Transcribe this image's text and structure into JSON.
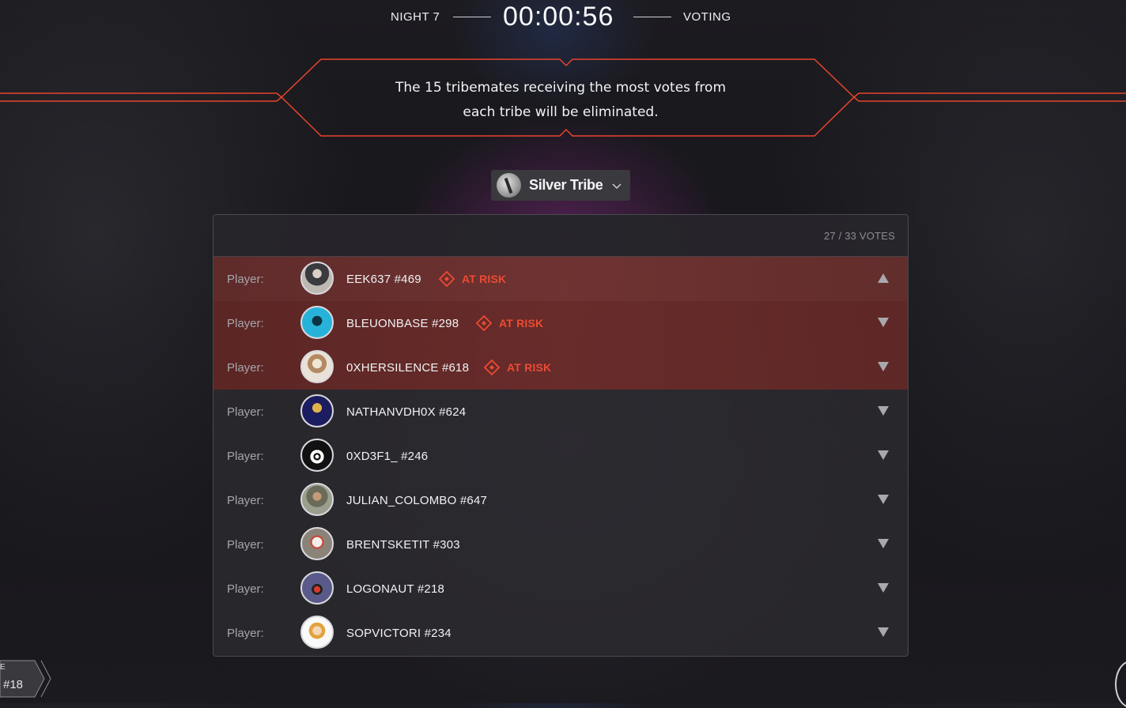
{
  "header": {
    "night": "NIGHT 7",
    "timer": "00:00:56",
    "phase": "VOTING"
  },
  "banner": {
    "message": "The 15 tribemates receiving the most votes from each tribe will be eliminated."
  },
  "tribe_selector": {
    "label": "Silver Tribe"
  },
  "panel": {
    "votes": "27 / 33 VOTES",
    "risk_label": "AT RISK",
    "rows": [
      {
        "label": "Player:",
        "name": "EEK637 #469",
        "at_risk": true,
        "arrow": "up"
      },
      {
        "label": "Player:",
        "name": "BLEUONBASE #298",
        "at_risk": true,
        "arrow": "down"
      },
      {
        "label": "Player:",
        "name": "0XHERSILENCE #618",
        "at_risk": true,
        "arrow": "down"
      },
      {
        "label": "Player:",
        "name": "NATHANVDH0X #624",
        "at_risk": false,
        "arrow": "down"
      },
      {
        "label": "Player:",
        "name": "0XD3F1_ #246",
        "at_risk": false,
        "arrow": "down"
      },
      {
        "label": "Player:",
        "name": "JULIAN_COLOMBO #647",
        "at_risk": false,
        "arrow": "down"
      },
      {
        "label": "Player:",
        "name": "BRENTSKETIT #303",
        "at_risk": false,
        "arrow": "down"
      },
      {
        "label": "Player:",
        "name": "LOGONAUT #218",
        "at_risk": false,
        "arrow": "down"
      },
      {
        "label": "Player:",
        "name": "SOPVICTORI #234",
        "at_risk": false,
        "arrow": "down"
      }
    ]
  },
  "footer": {
    "page_tag_prefix": "E",
    "page_number": "#18"
  },
  "colors": {
    "accent": "#e8452c",
    "risk_text": "#ee4a32"
  },
  "icons": {
    "risk": "diamond-warning-icon",
    "up": "triangle-up-icon",
    "down": "triangle-down-icon",
    "chevron": "chevron-down-icon"
  }
}
